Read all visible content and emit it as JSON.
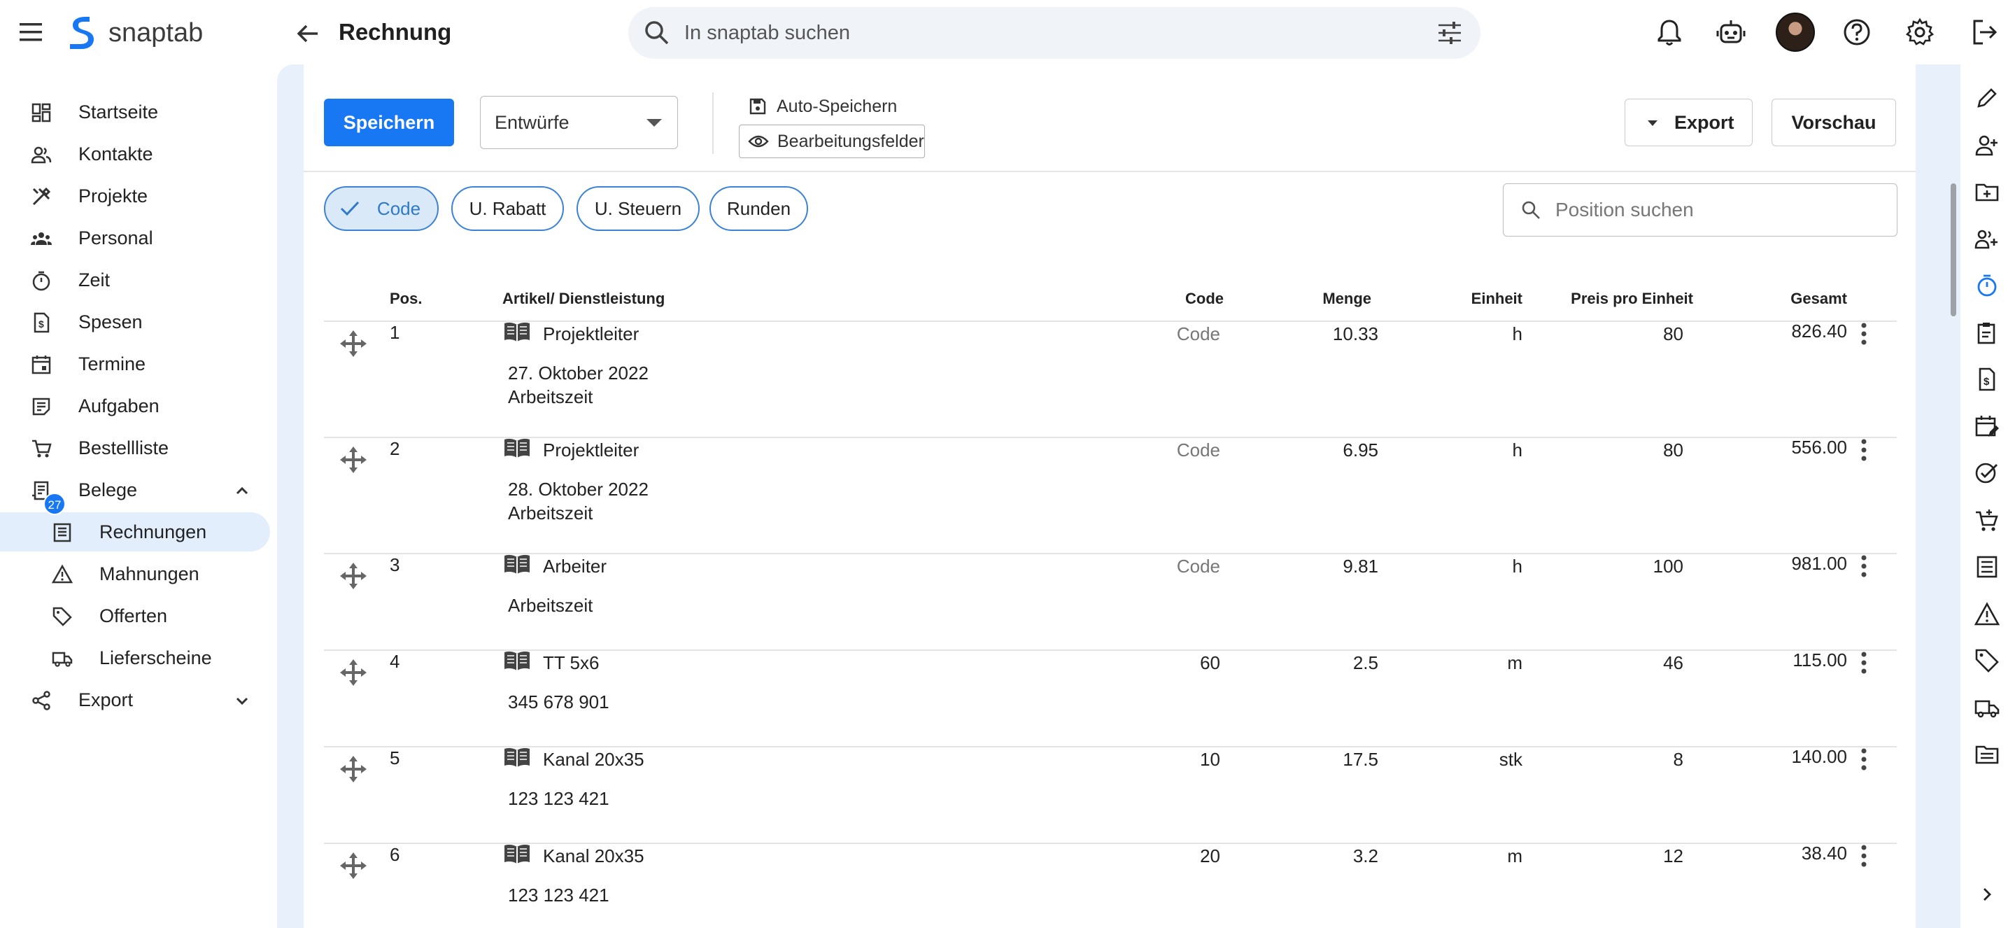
{
  "app": {
    "name": "snaptab",
    "page_title": "Rechnung"
  },
  "search": {
    "placeholder": "In snaptab suchen"
  },
  "sidebar": {
    "items": [
      {
        "label": "Startseite",
        "icon": "dashboard-icon"
      },
      {
        "label": "Kontakte",
        "icon": "contacts-icon"
      },
      {
        "label": "Projekte",
        "icon": "tools-icon"
      },
      {
        "label": "Personal",
        "icon": "people-icon"
      },
      {
        "label": "Zeit",
        "icon": "timer-icon"
      },
      {
        "label": "Spesen",
        "icon": "receipt-icon"
      },
      {
        "label": "Termine",
        "icon": "calendar-icon"
      },
      {
        "label": "Aufgaben",
        "icon": "task-icon"
      },
      {
        "label": "Bestellliste",
        "icon": "cart-icon",
        "badge": "27"
      },
      {
        "label": "Belege",
        "icon": "document-icon",
        "expanded": true
      },
      {
        "label": "Rechnungen",
        "icon": "invoice-icon",
        "active": true
      },
      {
        "label": "Mahnungen",
        "icon": "warning-icon"
      },
      {
        "label": "Offerten",
        "icon": "tag-icon"
      },
      {
        "label": "Lieferscheine",
        "icon": "truck-icon"
      },
      {
        "label": "Export",
        "icon": "share-icon"
      }
    ]
  },
  "toolbar": {
    "save_label": "Speichern",
    "draft_select": "Entwürfe",
    "autosave_label": "Auto-Speichern",
    "edit_fields_label": "Bearbeitungsfelder",
    "export_label": "Export",
    "preview_label": "Vorschau"
  },
  "chips": [
    {
      "label": "Code",
      "selected": true
    },
    {
      "label": "U. Rabatt",
      "selected": false
    },
    {
      "label": "U. Steuern",
      "selected": false
    },
    {
      "label": "Runden",
      "selected": false
    }
  ],
  "position_search": {
    "placeholder": "Position suchen"
  },
  "table": {
    "headers": {
      "pos": "Pos.",
      "article": "Artikel/ Dienstleistung",
      "code": "Code",
      "qty": "Menge",
      "unit": "Einheit",
      "price": "Preis pro Einheit",
      "total": "Gesamt"
    },
    "rows": [
      {
        "pos": "1",
        "article": "Projektleiter",
        "desc": [
          "27. Oktober 2022",
          "Arbeitszeit"
        ],
        "code": "Code",
        "code_placeholder": true,
        "qty": "10.33",
        "unit": "h",
        "price": "80",
        "total": "826.40"
      },
      {
        "pos": "2",
        "article": "Projektleiter",
        "desc": [
          "28. Oktober 2022",
          "Arbeitszeit"
        ],
        "code": "Code",
        "code_placeholder": true,
        "qty": "6.95",
        "unit": "h",
        "price": "80",
        "total": "556.00"
      },
      {
        "pos": "3",
        "article": "Arbeiter",
        "desc": [
          "Arbeitszeit"
        ],
        "code": "Code",
        "code_placeholder": true,
        "qty": "9.81",
        "unit": "h",
        "price": "100",
        "total": "981.00"
      },
      {
        "pos": "4",
        "article": "TT 5x6",
        "desc": [
          "345 678 901"
        ],
        "code": "60",
        "code_placeholder": false,
        "qty": "2.5",
        "unit": "m",
        "price": "46",
        "total": "115.00"
      },
      {
        "pos": "5",
        "article": "Kanal 20x35",
        "desc": [
          "123 123 421"
        ],
        "code": "10",
        "code_placeholder": false,
        "qty": "17.5",
        "unit": "stk",
        "price": "8",
        "total": "140.00"
      },
      {
        "pos": "6",
        "article": "Kanal 20x35",
        "desc": [
          "123 123 421"
        ],
        "code": "20",
        "code_placeholder": false,
        "qty": "3.2",
        "unit": "m",
        "price": "12",
        "total": "38.40"
      }
    ]
  },
  "right_rail": [
    "edit-icon",
    "add-contact-icon",
    "new-folder-icon",
    "add-person-icon",
    "timer-icon",
    "clipboard-icon",
    "receipt-icon",
    "calendar-edit-icon",
    "task-done-icon",
    "cart-add-icon",
    "invoice-icon",
    "warning-icon",
    "tag-icon",
    "truck-icon",
    "folder-icon",
    "chevron-right-icon"
  ],
  "colors": {
    "accent": "#1877f2",
    "canvas_bg": "#e8f0fc",
    "chip_border": "#3b82d6"
  }
}
